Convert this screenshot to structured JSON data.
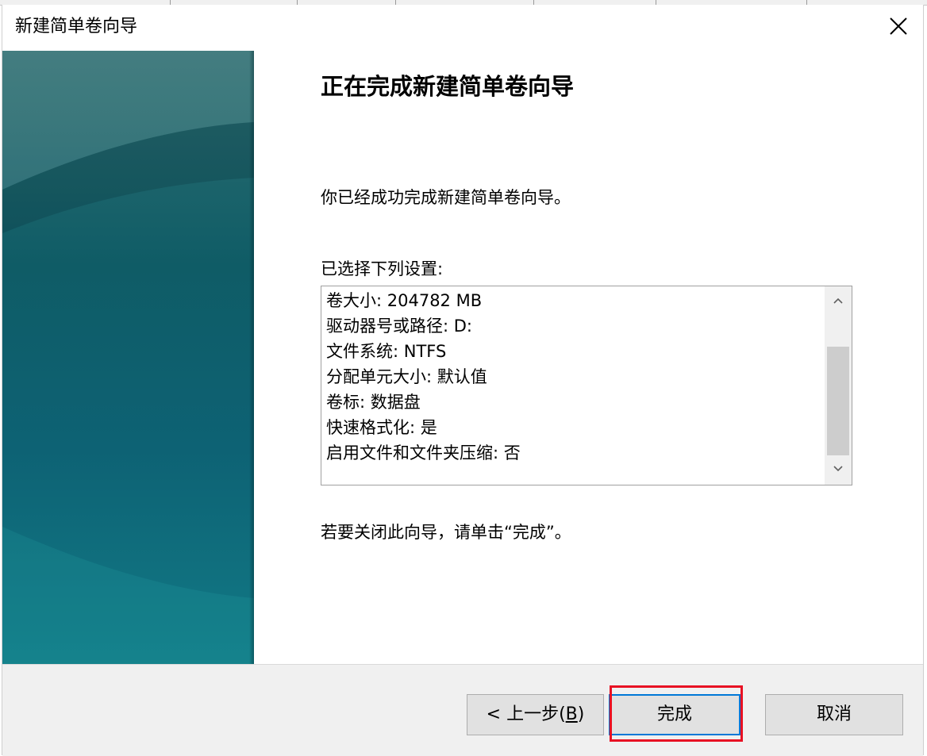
{
  "window": {
    "title": "新建简单卷向导",
    "close_glyph": "✕"
  },
  "page": {
    "heading": "正在完成新建简单卷向导",
    "success_text": "你已经成功完成新建简单卷向导。",
    "selected_label": "已选择下列设置:",
    "close_hint": "若要关闭此向导，请单击“完成”。"
  },
  "settings": [
    "卷大小: 204782 MB",
    "驱动器号或路径: D:",
    "文件系统: NTFS",
    "分配单元大小: 默认值",
    "卷标: 数据盘",
    "快速格式化: 是",
    "启用文件和文件夹压缩: 否"
  ],
  "buttons": {
    "back_prefix": "< 上一步(",
    "back_key": "B",
    "back_suffix": ")",
    "finish": "完成",
    "cancel": "取消"
  },
  "icons": {
    "close": "close-icon",
    "scroll_up": "chevron-up-icon",
    "scroll_down": "chevron-down-icon"
  },
  "colors": {
    "banner_top": "#2f6f72",
    "banner_bottom": "#127a86",
    "focus_border": "#0078d7",
    "highlight": "#e81123"
  }
}
